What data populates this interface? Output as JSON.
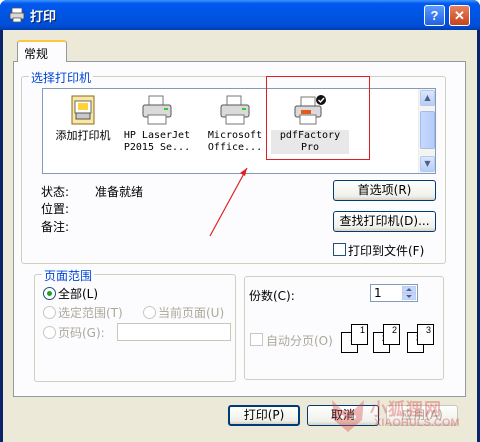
{
  "window": {
    "title": "打印",
    "help_glyph": "?",
    "close_glyph": "✕"
  },
  "tabs": [
    {
      "label": "常规"
    }
  ],
  "select_printer": {
    "legend": "选择打印机",
    "printers": [
      {
        "label_line1": "添加打印机",
        "label_line2": "",
        "icon": "add-printer-icon"
      },
      {
        "label_line1": "HP LaserJet",
        "label_line2": "P2015 Se...",
        "icon": "printer-icon"
      },
      {
        "label_line1": "Microsoft",
        "label_line2": "Office...",
        "icon": "printer-icon"
      },
      {
        "label_line1": "pdfFactory",
        "label_line2": "Pro",
        "icon": "default-printer-icon",
        "selected": true
      }
    ],
    "status_label": "状态:",
    "status_value": "准备就绪",
    "location_label": "位置:",
    "location_value": "",
    "comment_label": "备注:",
    "comment_value": "",
    "preferences_button": "首选项(R)",
    "find_printer_button": "查找打印机(D)...",
    "print_to_file_label": "打印到文件(F)"
  },
  "page_range": {
    "legend": "页面范围",
    "all_label": "全部(L)",
    "selection_label": "选定范围(T)",
    "current_page_label": "当前页面(U)",
    "pages_label": "页码(G):",
    "pages_value": ""
  },
  "copies": {
    "label": "份数(C):",
    "value": "1",
    "collate_label": "自动分页(O)",
    "collate_pages": [
      "1",
      "1",
      "2",
      "2",
      "3",
      "3"
    ]
  },
  "footer": {
    "print_button": "打印(P)",
    "cancel_button": "取消",
    "apply_button": "应用(A)"
  },
  "watermark": {
    "text": "小狐狸网",
    "subtext": "XIAOHULS.COM"
  },
  "colors": {
    "titlebar": "#0054e3",
    "group_legend": "#0046d5",
    "annotation_red": "#e02020"
  }
}
